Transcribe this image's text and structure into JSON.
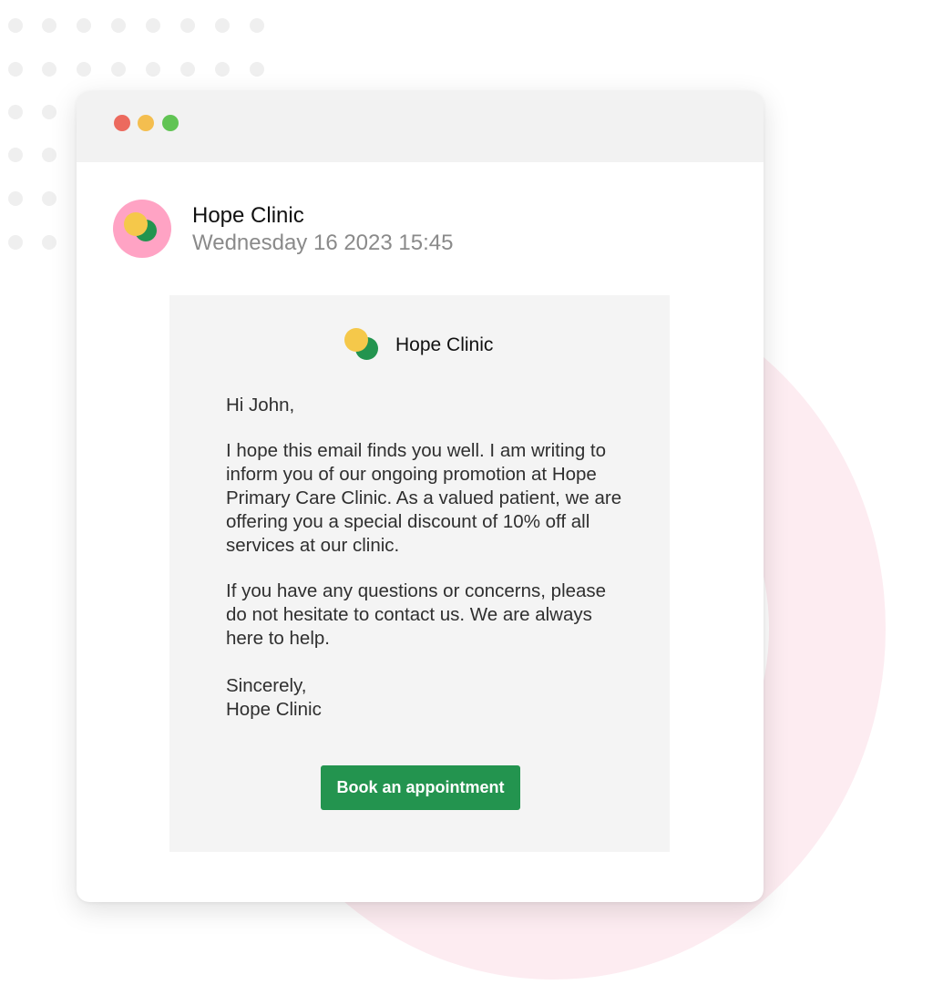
{
  "colors": {
    "traffic_close": "#ec6a5e",
    "traffic_minimize": "#f4be4f",
    "traffic_maximize": "#61c454",
    "avatar_background": "#ffa3c4",
    "logo_yellow": "#f5c84a",
    "logo_green": "#23944f",
    "button_background": "#23944f",
    "decorative_ring": "#fdecf1",
    "decorative_dots": "#efefef"
  },
  "window": {
    "controls": [
      "close",
      "minimize",
      "maximize"
    ]
  },
  "sender": {
    "name": "Hope Clinic",
    "date": "Wednesday 16 2023  15:45",
    "avatar_icon": "clinic-logo-icon"
  },
  "email": {
    "brand_name": "Hope Clinic",
    "brand_icon": "clinic-logo-icon",
    "greeting": "Hi John,",
    "paragraph_1": "I hope this email finds you well. I am writing to inform you of our ongoing promotion at Hope Primary Care Clinic. As a valued patient, we are offering you a special discount of 10% off all services at our clinic.",
    "paragraph_2": "If you have any questions or concerns, please do not hesitate to contact us. We are always here to help.",
    "sign_off": "Sincerely,",
    "signature": "Hope Clinic",
    "cta_label": "Book an appointment"
  }
}
